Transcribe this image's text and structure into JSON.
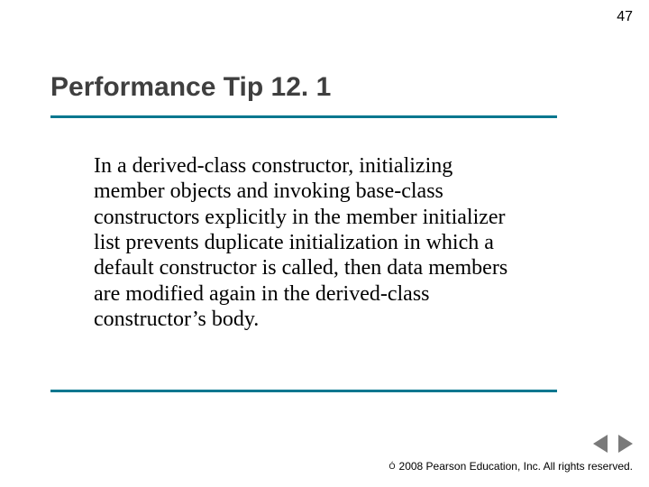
{
  "page_number": "47",
  "title": "Performance Tip 12. 1",
  "body": "In a derived-class constructor, initializing member objects and invoking base-class constructors explicitly in the member initializer list prevents duplicate initialization in which a default constructor is called, then data members are modified again in the derived-class constructor’s body.",
  "copyright_symbol": "Ó",
  "copyright": "2008 Pearson Education, Inc.  All rights reserved.",
  "accent_color": "#04778f"
}
